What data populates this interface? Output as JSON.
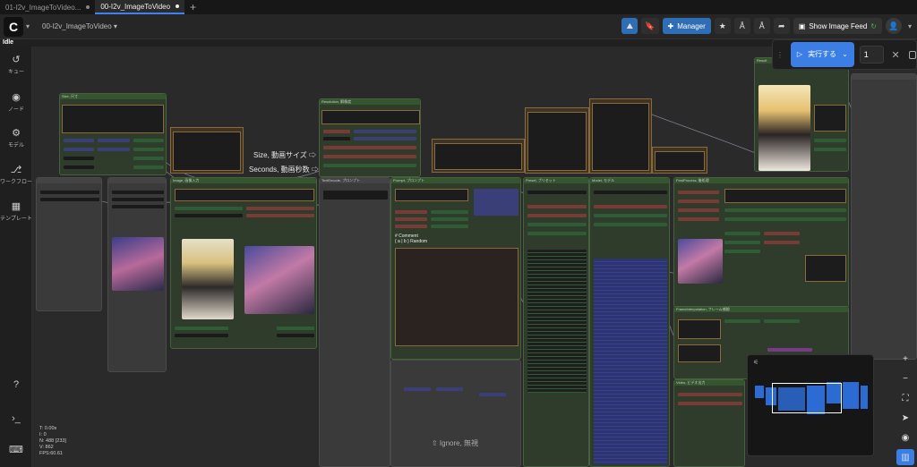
{
  "tabs": [
    {
      "label": "01-I2v_ImageToVideo...",
      "active": false
    },
    {
      "label": "00-I2v_ImageToVideo",
      "active": true
    }
  ],
  "topbar": {
    "workflow_name": "00-I2v_ImageToVideo",
    "manager_label": "Manager",
    "image_feed_label": "Show Image Feed"
  },
  "status": {
    "text": "Idle"
  },
  "sidebar": {
    "items": [
      {
        "label": "キュー",
        "icon": "history-icon"
      },
      {
        "label": "ノード",
        "icon": "eye-icon"
      },
      {
        "label": "モデル",
        "icon": "model-icon"
      },
      {
        "label": "ワークフロー",
        "icon": "workflow-icon"
      },
      {
        "label": "テンプレート",
        "icon": "template-icon"
      }
    ],
    "bottom": [
      {
        "icon": "help-icon"
      },
      {
        "icon": "terminal-icon"
      },
      {
        "icon": "keyboard-icon"
      }
    ]
  },
  "run_panel": {
    "run_label": "実行する",
    "count": "1"
  },
  "canvas_labels": {
    "size_note": "Size, 動画サイズ ⇨",
    "seconds_note": "Seconds, 動画秒数 ⇨",
    "ignore_note": "⇧ Ignore, 無視",
    "comment_line1": "# Comment",
    "comment_line2": "{ a | b } Random"
  },
  "stats": {
    "t": "T: 0.00s",
    "i": "I: 0",
    "n": "N: 488 [233]",
    "v": "V: 862",
    "fps": "FPS:60.61"
  },
  "colors": {
    "accent": "#3a7ee6",
    "node_green": "#35552f",
    "group_brown": "#8a6a3a"
  }
}
